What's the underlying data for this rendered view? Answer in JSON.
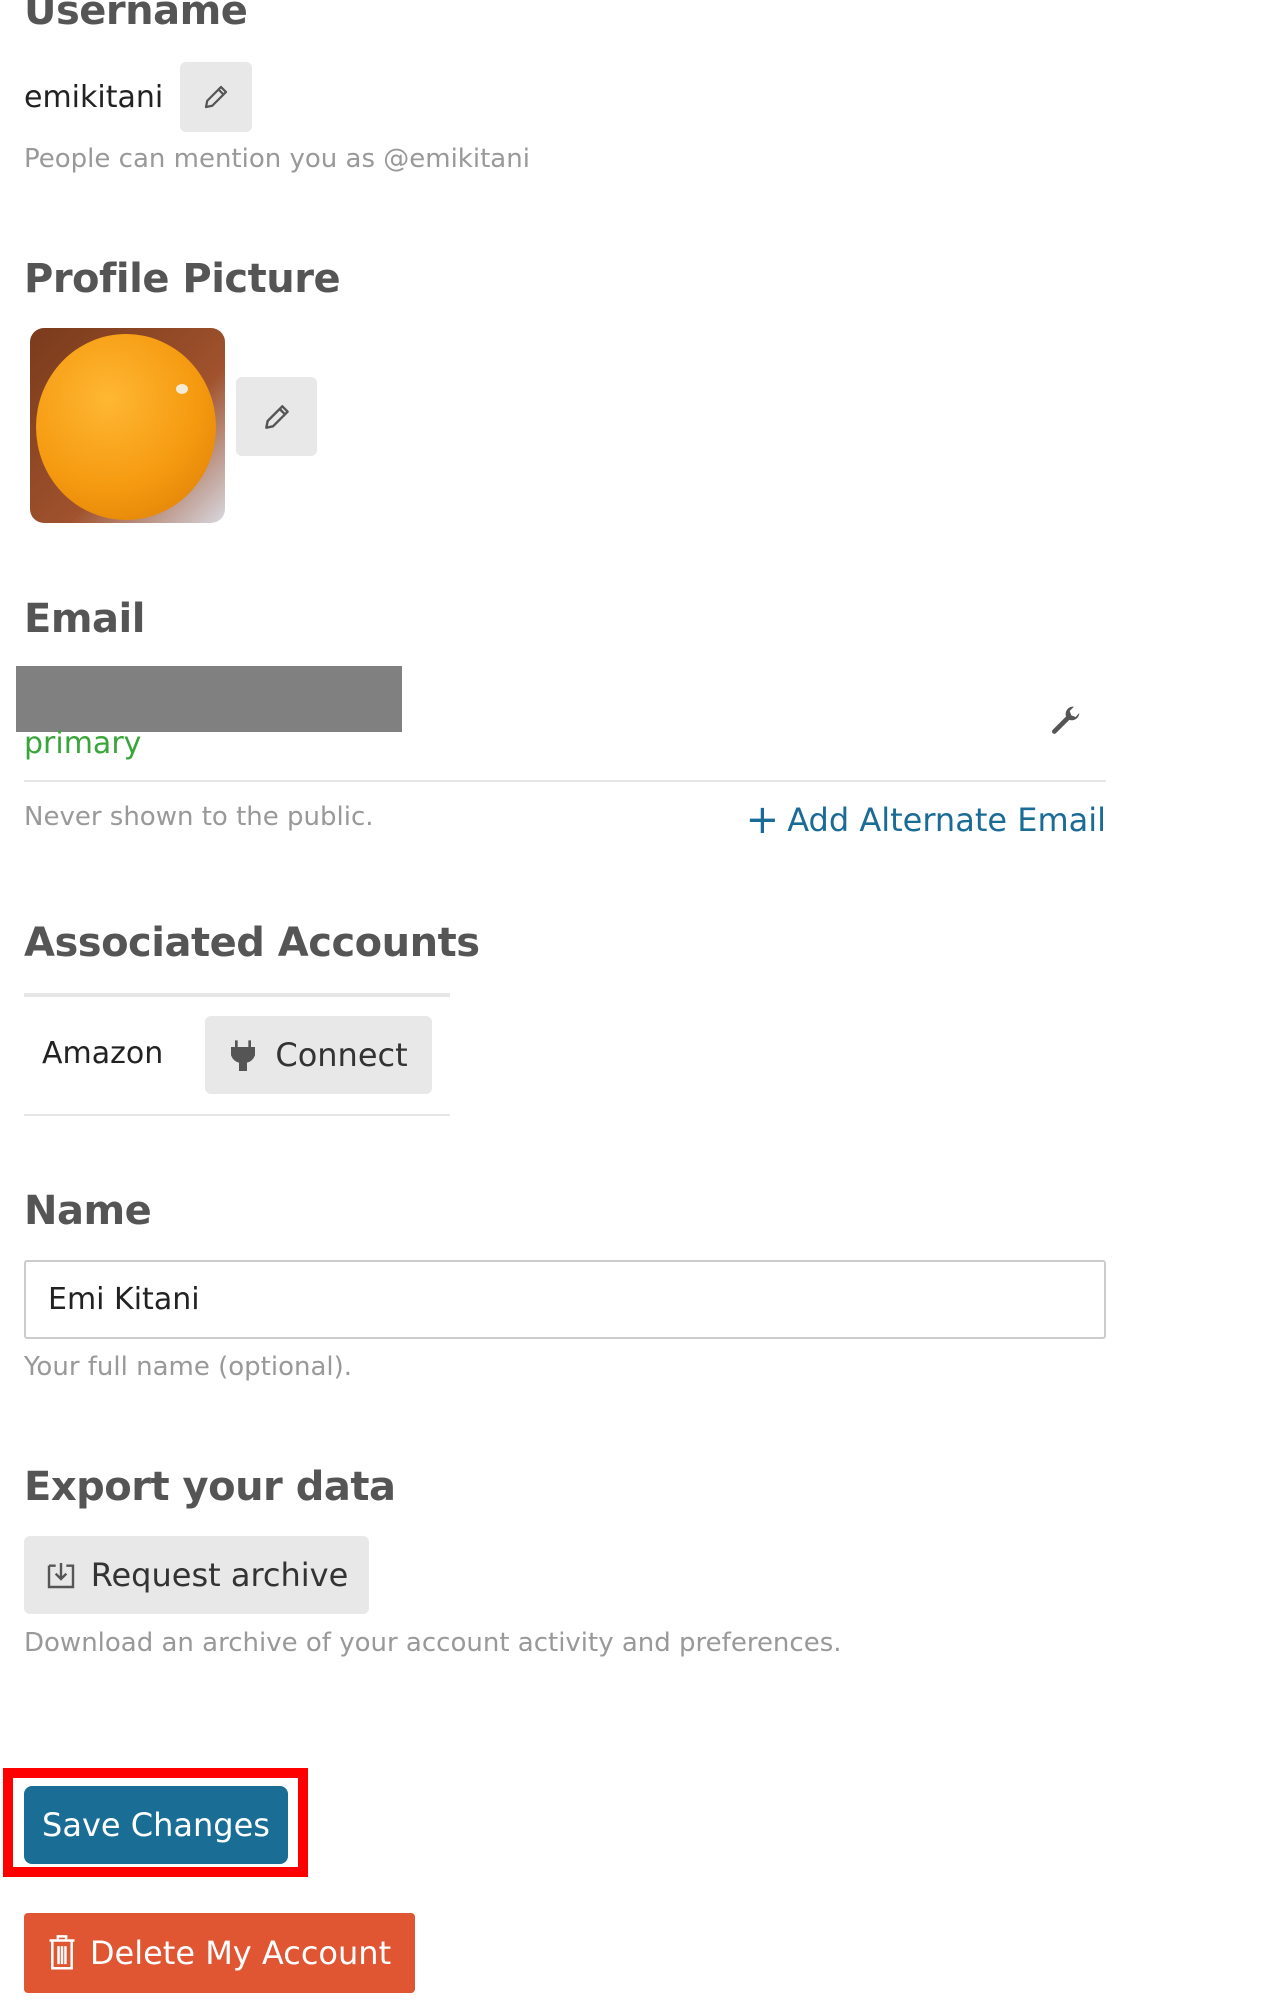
{
  "username": {
    "heading": "Username",
    "value": "emikitani",
    "helper": "People can mention you as @emikitani",
    "edit_icon": "pencil-icon"
  },
  "profile_picture": {
    "heading": "Profile Picture",
    "edit_icon": "pencil-icon"
  },
  "email": {
    "heading": "Email",
    "badge": "primary",
    "helper": "Never shown to the public.",
    "add_alternate_label": "Add Alternate Email",
    "settings_icon": "wrench-icon",
    "badge_color": "#3aa53a",
    "link_color": "#1b6b97"
  },
  "associated_accounts": {
    "heading": "Associated Accounts",
    "items": [
      {
        "provider": "Amazon",
        "button_label": "Connect",
        "icon": "plug-icon"
      }
    ]
  },
  "name": {
    "heading": "Name",
    "value": "Emi Kitani",
    "helper": "Your full name (optional)."
  },
  "export": {
    "heading": "Export your data",
    "button_label": "Request archive",
    "icon": "download-icon",
    "helper": "Download an archive of your account activity and preferences."
  },
  "actions": {
    "save_label": "Save Changes",
    "delete_label": "Delete My Account",
    "save_color": "#1a6e96",
    "delete_color": "#e05633",
    "highlight_color": "#ff0000"
  }
}
